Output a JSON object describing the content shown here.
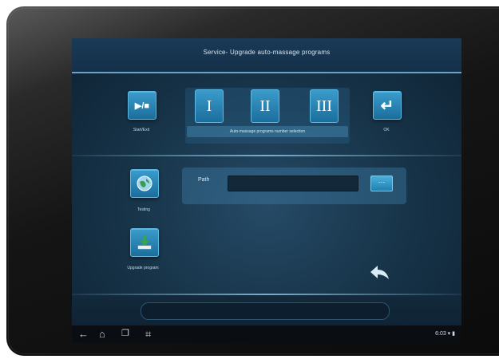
{
  "window": {
    "title": "Service- Upgrade auto-massage programs"
  },
  "toolbar": {
    "start_exit": {
      "icon": "play-stop-icon",
      "glyph": "▶/■",
      "label": "Start/Exit"
    },
    "programs": {
      "items": [
        {
          "label": "I"
        },
        {
          "label": "II"
        },
        {
          "label": "III"
        }
      ],
      "caption": "Auto-massage programs number selection"
    },
    "ok": {
      "icon": "enter-icon",
      "glyph": "↵",
      "label": "OK"
    }
  },
  "side": {
    "testing": {
      "icon": "globe-icon",
      "label": "Testing"
    },
    "upgrade": {
      "icon": "download-icon",
      "label": "Upgrade program"
    }
  },
  "path": {
    "label": "Path",
    "value": "",
    "browse_glyph": "⋯",
    "browse_icon": "ellipsis-icon"
  },
  "back": {
    "icon": "return-arrow-icon",
    "glyph": "↩"
  },
  "navbar": {
    "back_glyph": "←",
    "home_glyph": "⌂",
    "recents_glyph": "❐",
    "screenshot_glyph": "⌗",
    "status": "6:03 ▾ ▮"
  },
  "colors": {
    "accent": "#2a8cc0",
    "screen_bg": "#173449",
    "separator": "#6aa3c4"
  }
}
